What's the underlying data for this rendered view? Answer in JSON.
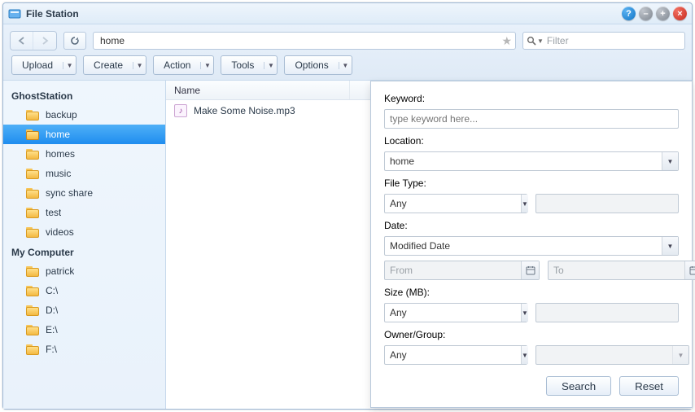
{
  "window": {
    "title": "File Station"
  },
  "path": {
    "value": "home"
  },
  "search": {
    "placeholder": "Filter"
  },
  "toolbar": {
    "upload": "Upload",
    "create": "Create",
    "action": "Action",
    "tools": "Tools",
    "options": "Options"
  },
  "sidebar": {
    "sections": [
      {
        "title": "GhostStation",
        "items": [
          {
            "label": "backup",
            "selected": false
          },
          {
            "label": "home",
            "selected": true
          },
          {
            "label": "homes",
            "selected": false
          },
          {
            "label": "music",
            "selected": false
          },
          {
            "label": "sync share",
            "selected": false
          },
          {
            "label": "test",
            "selected": false
          },
          {
            "label": "videos",
            "selected": false
          }
        ]
      },
      {
        "title": "My Computer",
        "items": [
          {
            "label": "patrick"
          },
          {
            "label": "C:\\"
          },
          {
            "label": "D:\\"
          },
          {
            "label": "E:\\"
          },
          {
            "label": "F:\\"
          }
        ]
      }
    ]
  },
  "columns": {
    "name": "Name"
  },
  "files": [
    {
      "name": "Make Some Noise.mp3",
      "type": "audio"
    }
  ],
  "panel": {
    "keyword_label": "Keyword:",
    "keyword_placeholder": "type keyword here...",
    "location_label": "Location:",
    "location_value": "home",
    "filetype_label": "File Type:",
    "filetype_value": "Any",
    "filetype_ext": "",
    "date_label": "Date:",
    "date_value": "Modified Date",
    "date_from_placeholder": "From",
    "date_to_placeholder": "To",
    "size_label": "Size (MB):",
    "size_value": "Any",
    "size_input": "",
    "owner_label": "Owner/Group:",
    "owner_value": "Any",
    "owner_input": "",
    "search_btn": "Search",
    "reset_btn": "Reset"
  }
}
